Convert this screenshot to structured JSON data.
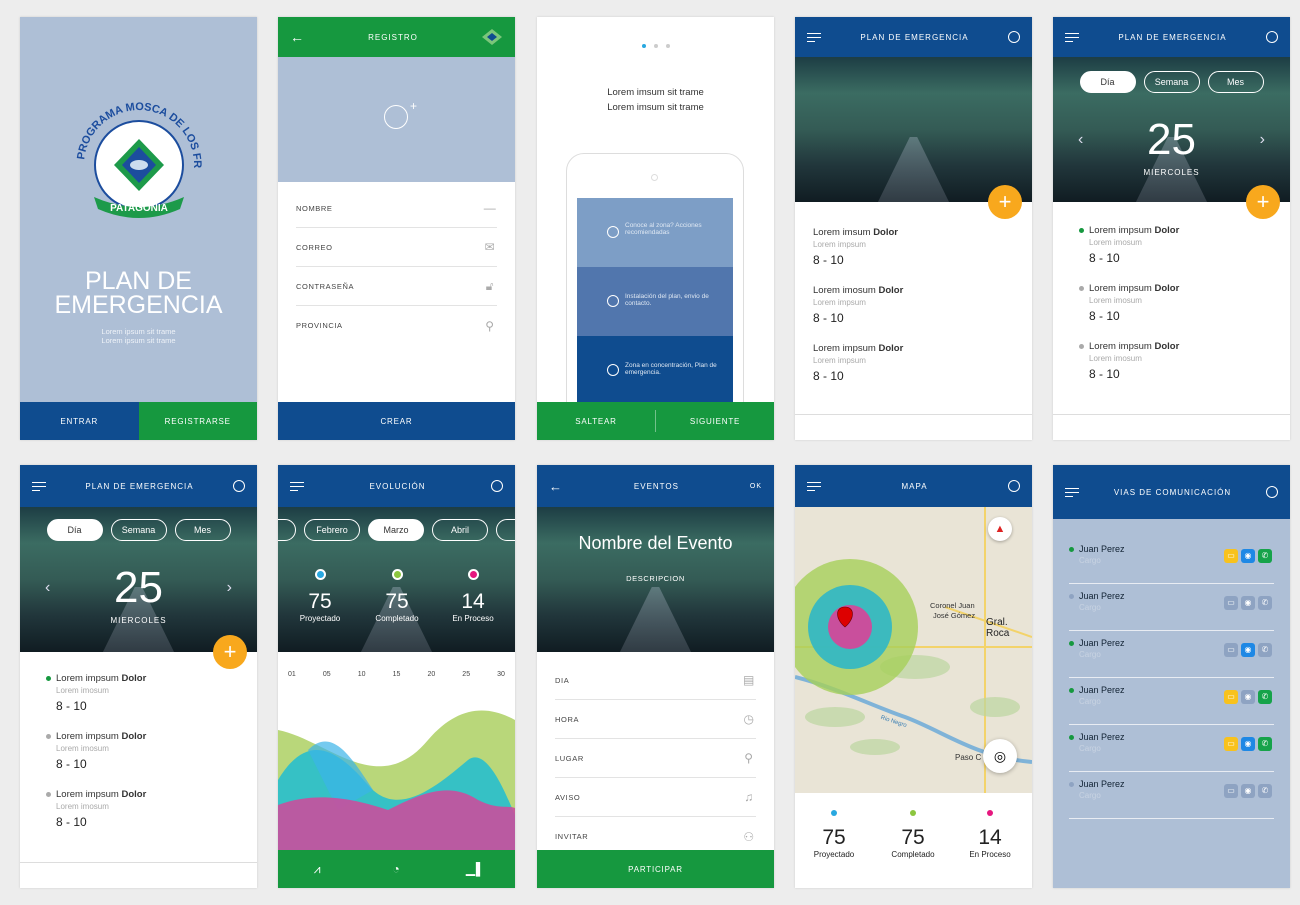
{
  "s1": {
    "title_line1": "PLAN DE",
    "title_line2": "EMERGENCIA",
    "sub1": "Lorem ipsum sit trame",
    "sub2": "Lorem ipsum sit trame",
    "logo_text_top": "PROGRAMA MOSCA DE LOS FRUTOS",
    "logo_text_bottom": "PATAGONIA",
    "btn_enter": "ENTRAR",
    "btn_register": "REGISTRARSE"
  },
  "s2": {
    "title": "REGISTRO",
    "fields": [
      "NOMBRE",
      "CORREO",
      "CONTRASEÑA",
      "PROVINCIA"
    ],
    "btn": "CREAR"
  },
  "s3": {
    "line1": "Lorem imsum sit trame",
    "line2": "Lorem imsum sit trame",
    "card1": "Conoce al zona? Acciones recomiendadas",
    "card2": "Instalación del plan, envio de contacto.",
    "card3": "Zona en concentración, Plan de emergencia.",
    "btn_skip": "SALTEAR",
    "btn_next": "SIGUIENTE"
  },
  "s4": {
    "title": "PLAN DE EMERGENCIA",
    "items": [
      {
        "title": "Lorem imsum ",
        "bold": "Dolor",
        "sub": "Lorem impsum",
        "range": "8 - 10"
      },
      {
        "title": "Lorem imosum ",
        "bold": "Dolor",
        "sub": "Lorem impsum",
        "range": "8 - 10"
      },
      {
        "title": "Lorem impsum ",
        "bold": "Dolor",
        "sub": "Lorem impsum",
        "range": "8 - 10"
      }
    ]
  },
  "s5": {
    "title": "PLAN DE EMERGENCIA",
    "tabs": [
      "Día",
      "Semana",
      "Mes"
    ],
    "day_num": "25",
    "day_name": "MIERCOLES",
    "items": [
      {
        "title": "Lorem impsum ",
        "bold": "Dolor",
        "sub": "Lorem imosum",
        "range": "8 - 10",
        "color": "#16983f"
      },
      {
        "title": "Lorem impsum ",
        "bold": "Dolor",
        "sub": "Lorem imosum",
        "range": "8 - 10",
        "color": "#aaaaaa"
      },
      {
        "title": "Lorem impsum ",
        "bold": "Dolor",
        "sub": "Lorem imosum",
        "range": "8 - 10",
        "color": "#aaaaaa"
      }
    ]
  },
  "s6": {
    "title": "PLAN DE EMERGENCIA",
    "tabs": [
      "Día",
      "Semana",
      "Mes"
    ],
    "day_num": "25",
    "day_name": "MIERCOLES",
    "items": [
      {
        "title": "Lorem impsum ",
        "bold": "Dolor",
        "sub": "Lorem imosum",
        "range": "8 - 10",
        "color": "#16983f"
      },
      {
        "title": "Lorem impsum ",
        "bold": "Dolor",
        "sub": "Lorem imosum",
        "range": "8 - 10",
        "color": "#aaaaaa"
      },
      {
        "title": "Lorem impsum ",
        "bold": "Dolor",
        "sub": "Lorem imosum",
        "range": "8 - 10",
        "color": "#aaaaaa"
      }
    ]
  },
  "s7": {
    "title": "EVOLUCIÓN",
    "months": [
      "Febrero",
      "Marzo",
      "Abril"
    ],
    "stats": [
      {
        "n": "75",
        "l": "Proyectado",
        "color": "#29a8e0"
      },
      {
        "n": "75",
        "l": "Completado",
        "color": "#8cc63f"
      },
      {
        "n": "14",
        "l": "En Proceso",
        "color": "#e6177f"
      }
    ],
    "axis": [
      "01",
      "05",
      "10",
      "15",
      "20",
      "25",
      "30"
    ]
  },
  "s8": {
    "title": "EVENTOS",
    "action": "OK",
    "event_name": "Nombre del Evento",
    "desc": "DESCRIPCION",
    "fields": [
      "DIA",
      "HORA",
      "LUGAR",
      "AVISO",
      "INVITAR"
    ],
    "btn": "PARTICIPAR"
  },
  "s9": {
    "title": "MAPA",
    "labels": [
      "Coronel Juan",
      "José Gómez",
      "Gral. Roca",
      "Paso C",
      "Rio Negro"
    ],
    "stats": [
      {
        "n": "75",
        "l": "Proyectado",
        "color": "#29a8e0"
      },
      {
        "n": "75",
        "l": "Completado",
        "color": "#8cc63f"
      },
      {
        "n": "14",
        "l": "En Proceso",
        "color": "#e6177f"
      }
    ]
  },
  "s10": {
    "title": "VIAS DE COMUNICACIÓN",
    "contacts": [
      {
        "name": "Juan Perez",
        "role": "Cargo",
        "dot": "#16983f",
        "apps": [
          1,
          1,
          1
        ]
      },
      {
        "name": "Juan Perez",
        "role": "Cargo",
        "dot": "#8ea3c2",
        "apps": [
          0,
          0,
          0
        ]
      },
      {
        "name": "Juan Perez",
        "role": "Cargo",
        "dot": "#16983f",
        "apps": [
          0,
          1,
          0
        ]
      },
      {
        "name": "Juan Perez",
        "role": "Cargo",
        "dot": "#16983f",
        "apps": [
          1,
          0,
          1
        ]
      },
      {
        "name": "Juan Perez",
        "role": "Cargo",
        "dot": "#16983f",
        "apps": [
          1,
          1,
          1
        ]
      },
      {
        "name": "Juan Perez",
        "role": "Cargo",
        "dot": "#8ea3c2",
        "apps": [
          0,
          0,
          0
        ]
      }
    ]
  },
  "colors": {
    "blue": "#0f4c8f",
    "green": "#16983f",
    "orange": "#f8a81d",
    "slate": "#aebfd6"
  }
}
